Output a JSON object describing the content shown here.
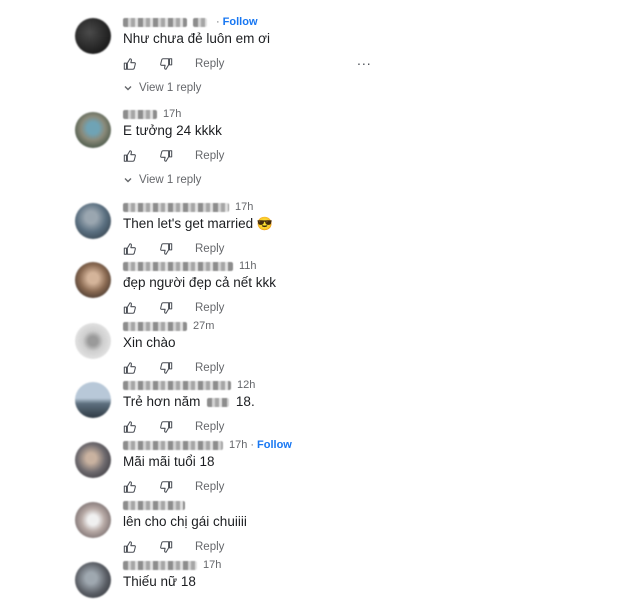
{
  "comments": [
    {
      "meta_tail": "·",
      "follow": "Follow",
      "text": "Như chưa đẻ luôn em ơi",
      "reply": "Reply",
      "view_replies": "View 1 reply"
    },
    {
      "time": "17h",
      "text": "E tưởng 24 kkkk",
      "reply": "Reply",
      "view_replies": "View 1 reply"
    },
    {
      "time": "17h",
      "text": "Then let's get married",
      "emoji": "😎",
      "reply": "Reply"
    },
    {
      "time": "11h",
      "text": "đẹp người đẹp cả nết kkk",
      "reply": "Reply"
    },
    {
      "time": "27m",
      "text": "Xin chào",
      "reply": "Reply"
    },
    {
      "time": "12h",
      "text_before": "Trẻ hơn năm",
      "text_after": "18.",
      "reply": "Reply"
    },
    {
      "time": "17h",
      "follow": "Follow",
      "text": "Mãi mãi tuổi 18",
      "reply": "Reply"
    },
    {
      "text": "lên cho chị gái chuiiii",
      "reply": "Reply"
    },
    {
      "time": "17h",
      "text": "Thiếu nữ 18"
    }
  ],
  "more_label": "...",
  "icons": {
    "like": "thumbs-up-icon",
    "dislike": "thumbs-down-icon",
    "chevron": "chevron-down-icon",
    "more": "more-options-icon"
  }
}
